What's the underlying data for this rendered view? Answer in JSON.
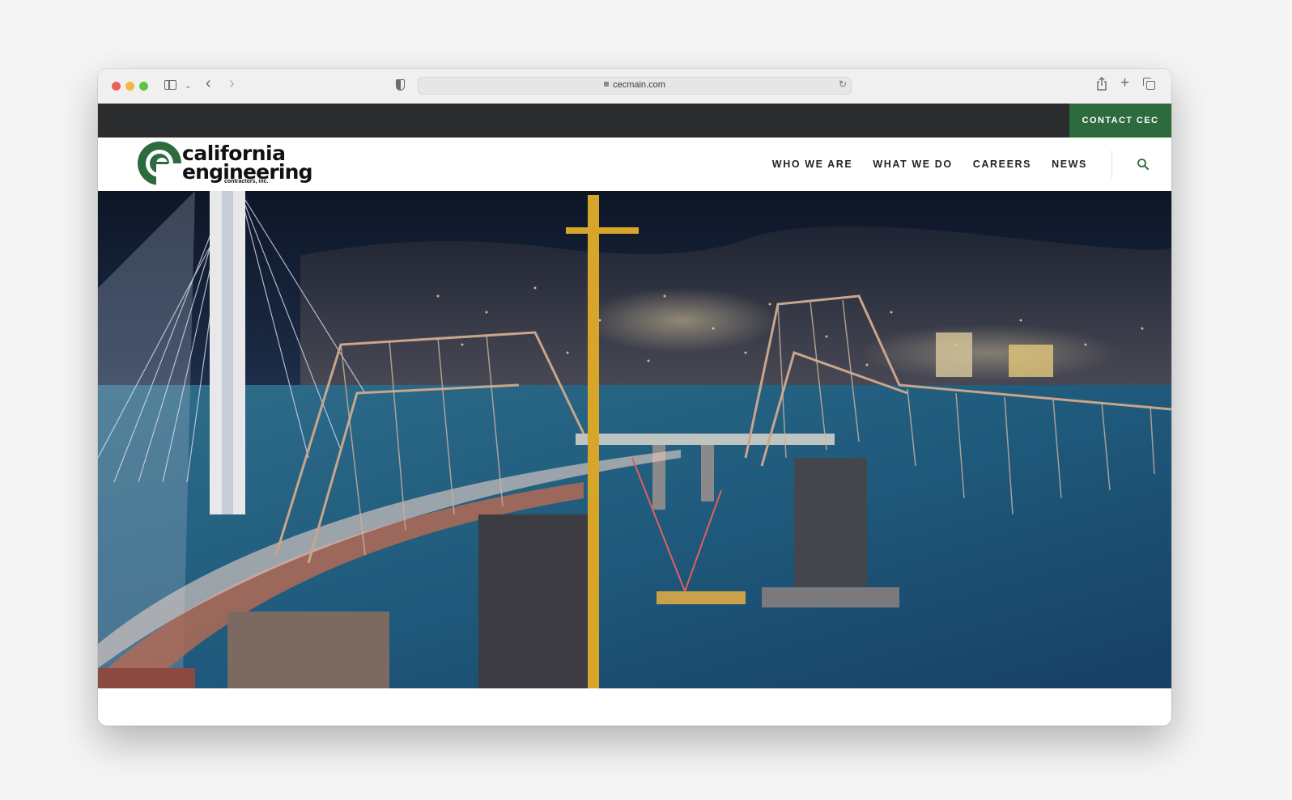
{
  "browser": {
    "url": "cecmain.com",
    "controls": [
      "close",
      "minimize",
      "zoom"
    ]
  },
  "site": {
    "topbar": {
      "contact_label": "CONTACT CEC"
    },
    "logo": {
      "line1": "california",
      "line2": "engineering",
      "line3": "contractors, inc."
    },
    "nav": [
      {
        "label": "WHO WE ARE"
      },
      {
        "label": "WHAT WE DO"
      },
      {
        "label": "CAREERS"
      },
      {
        "label": "NEWS"
      }
    ],
    "colors": {
      "brand_green": "#2d6a3e",
      "topbar_dark": "#2b2c2d"
    },
    "hero": {
      "description": "Night photo of San Francisco–Oakland Bay Bridge construction with self-anchored suspension tower, old truss spans, tower crane and city lights"
    }
  }
}
